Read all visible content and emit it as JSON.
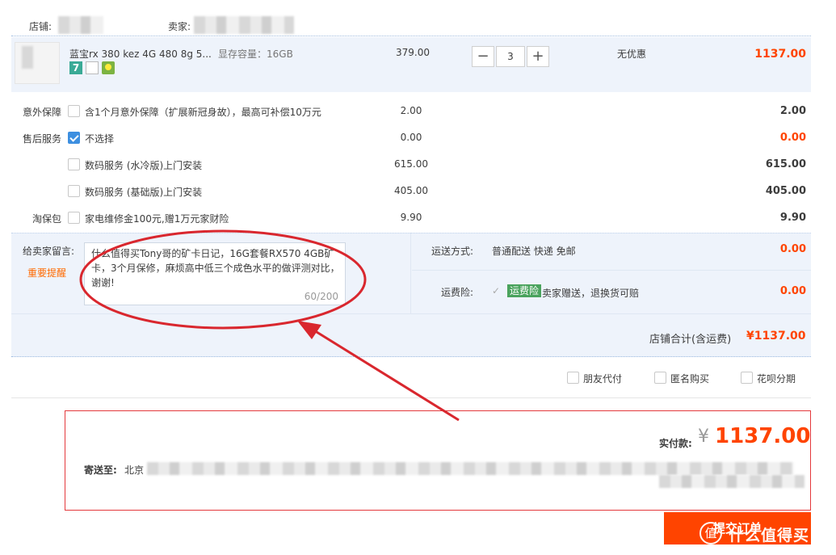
{
  "shop": {
    "shop_label": "店铺:",
    "seller_label": "卖家:"
  },
  "item": {
    "title": "蓝宝rx 380 kez 4G 480 8g 5...",
    "spec": "显存容量：16GB",
    "unit_price": "379.00",
    "quantity": "3",
    "discount": "无优惠",
    "subtotal": "1137.00",
    "badge_text": "7"
  },
  "services": [
    {
      "group": "意外保障",
      "label": "含1个月意外保障（扩展新冠身故），最高可补偿10万元",
      "price": "2.00",
      "total": "2.00",
      "checked": false
    },
    {
      "group": "售后服务",
      "label": "不选择",
      "price": "0.00",
      "total": "0.00",
      "checked": true
    },
    {
      "group": "",
      "label": "数码服务 (水冷版)上门安装",
      "price": "615.00",
      "total": "615.00",
      "checked": false
    },
    {
      "group": "",
      "label": "数码服务 (基础版)上门安装",
      "price": "405.00",
      "total": "405.00",
      "checked": false
    },
    {
      "group": "淘保包",
      "label": "家电维修金100元,赠1万元家财险",
      "price": "9.90",
      "total": "9.90",
      "checked": false
    }
  ],
  "message": {
    "label": "给卖家留言:",
    "reminder": "重要提醒",
    "text": "什么值得买Tony哥的矿卡日记，16G套餐RX570 4GB矿卡，3个月保修，麻烦高中低三个成色水平的做评测对比，谢谢!",
    "counter": "60/200"
  },
  "shipping": {
    "method_label": "运送方式:",
    "method_value": "普通配送 快递 免邮",
    "method_price": "0.00",
    "insurance_label": "运费险:",
    "insurance_badge": "运费险",
    "insurance_text": "卖家赠送，退换货可赔",
    "insurance_price": "0.00"
  },
  "shop_total": {
    "label": "店铺合计(含运费)",
    "value": "¥1137.00"
  },
  "options": {
    "friend_pay": "朋友代付",
    "anonymous": "匿名购买",
    "huabei": "花呗分期"
  },
  "summary": {
    "paid_label": "实付款:",
    "currency": "¥",
    "paid_value": "1137.00",
    "ship_to_label": "寄送至:",
    "ship_to_city": "北京"
  },
  "submit": {
    "label": "提交订单"
  },
  "watermark": {
    "text": "值 什么值得买"
  },
  "colors": {
    "accent": "#ff4400",
    "annotation_red": "#d9272e",
    "light_blue_bg": "#eef3fb",
    "badge_green": "#4aa35d"
  }
}
